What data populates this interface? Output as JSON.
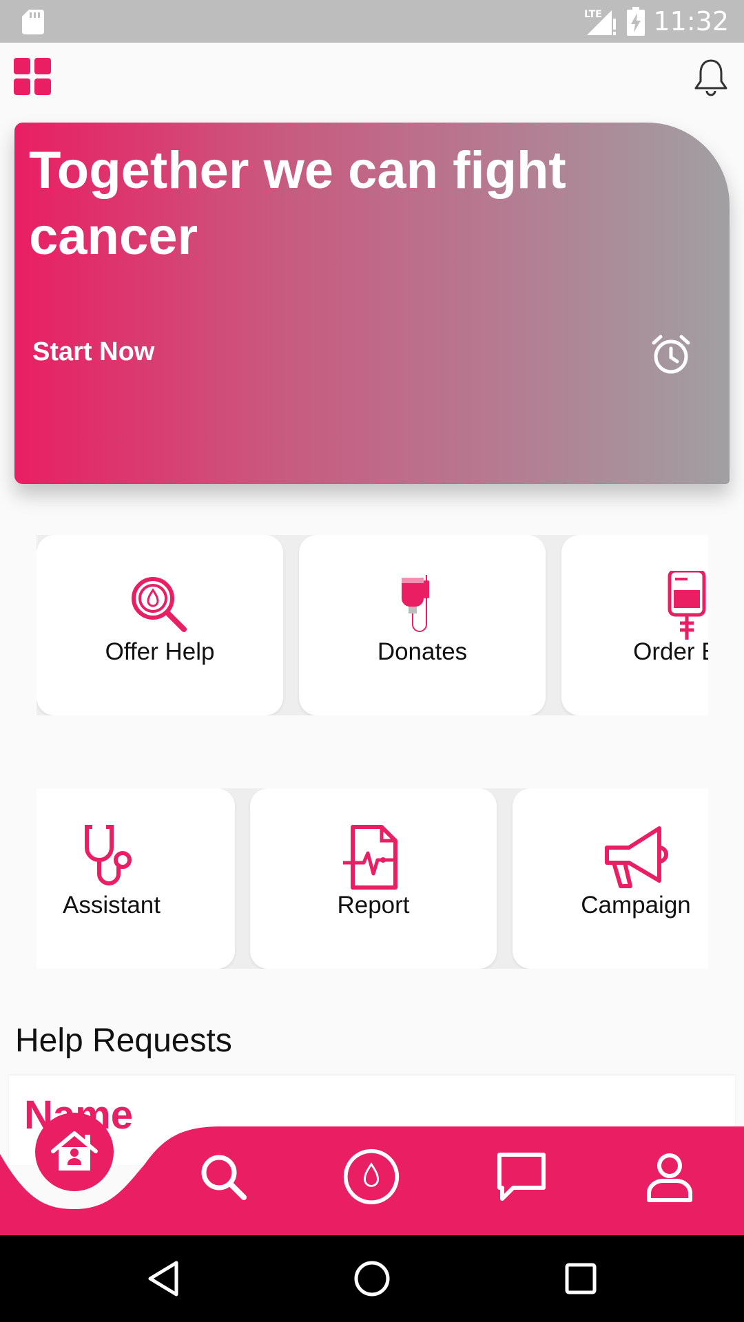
{
  "status_bar": {
    "time": "11:32",
    "network": "LTE",
    "icons": [
      "sd-card-icon",
      "signal-icon",
      "battery-charging-icon"
    ]
  },
  "header": {
    "menu_icon": "grid-icon",
    "notification_icon": "bell-icon"
  },
  "hero": {
    "title": "Together we can fight cancer",
    "cta_label": "Start Now",
    "icon": "alarm-icon"
  },
  "features": {
    "row1": [
      {
        "label": "Offer Help",
        "icon": "blood-search-icon"
      },
      {
        "label": "Donates",
        "icon": "blood-bag-drip-icon"
      },
      {
        "label": "Order Blo",
        "icon": "blood-bag-icon"
      }
    ],
    "row2": [
      {
        "label": "Assistant",
        "icon": "stethoscope-icon"
      },
      {
        "label": "Report",
        "icon": "medical-report-icon"
      },
      {
        "label": "Campaign",
        "icon": "megaphone-icon"
      }
    ]
  },
  "help_requests": {
    "title": "Help Requests",
    "first_item_name": "Name"
  },
  "bottom_nav": {
    "items": [
      "home-icon",
      "search-icon",
      "blood-drop-icon",
      "chat-icon",
      "profile-icon"
    ],
    "active": "home-icon"
  },
  "colors": {
    "accent": "#e91e63",
    "gradient_end": "#a0a0a2",
    "status_bar": "#bdbdbd",
    "background": "#fafafa"
  }
}
